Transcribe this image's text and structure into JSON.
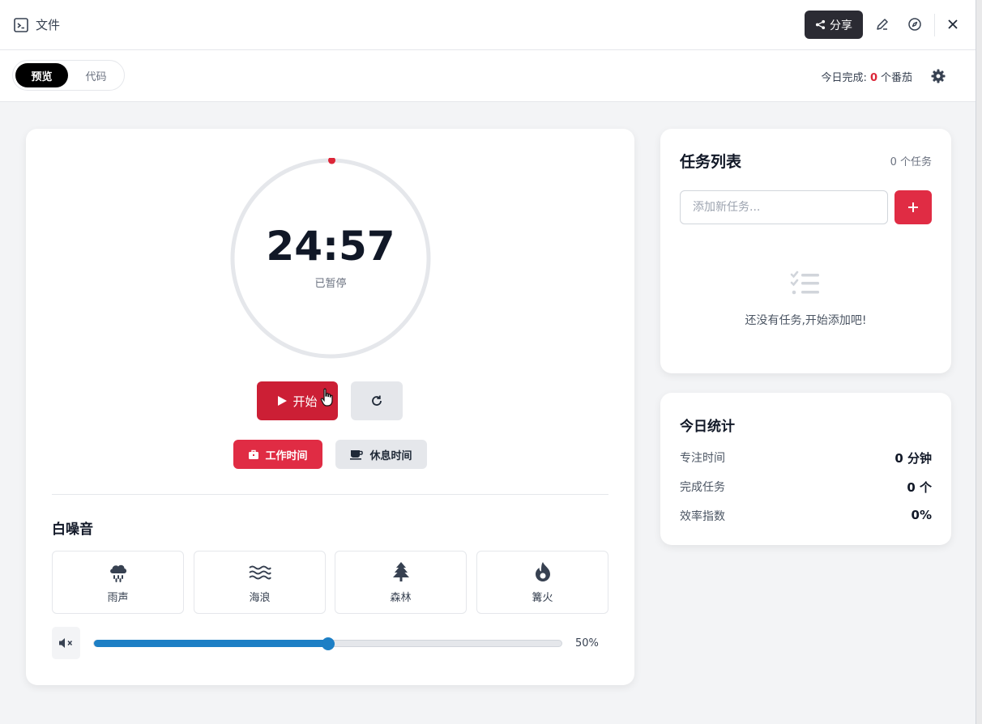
{
  "topbar": {
    "file_label": "文件",
    "share_label": "分享",
    "icons": [
      "terminal-file-icon",
      "share-icon",
      "pencil-icon",
      "compass-icon",
      "close-icon"
    ]
  },
  "subbar": {
    "tabs": [
      {
        "label": "预览",
        "active": true
      },
      {
        "label": "代码",
        "active": false
      }
    ],
    "today_prefix": "今日完成:",
    "today_count": "0",
    "today_suffix": "个番茄"
  },
  "timer": {
    "time": "24:57",
    "state": "已暂停",
    "start_label": "开始",
    "progress": 0.002,
    "modes": [
      {
        "label": "工作时间",
        "active": true,
        "icon": "briefcase-icon"
      },
      {
        "label": "休息时间",
        "active": false,
        "icon": "coffee-icon"
      }
    ]
  },
  "noise": {
    "title": "白噪音",
    "items": [
      {
        "label": "雨声",
        "icon": "rain-cloud-icon"
      },
      {
        "label": "海浪",
        "icon": "water-waves-icon"
      },
      {
        "label": "森林",
        "icon": "tree-icon"
      },
      {
        "label": "篝火",
        "icon": "fire-icon"
      }
    ],
    "volume": 50,
    "volume_label": "50%"
  },
  "tasks": {
    "title": "任务列表",
    "count_label": "0 个任务",
    "input_placeholder": "添加新任务...",
    "empty_text": "还没有任务,开始添加吧!"
  },
  "stats": {
    "title": "今日统计",
    "rows": [
      {
        "label": "专注时间",
        "value": "0 分钟"
      },
      {
        "label": "完成任务",
        "value": "0 个"
      },
      {
        "label": "效率指数",
        "value": "0%"
      }
    ]
  },
  "colors": {
    "accent_red": "#cc1f35",
    "accent_red_light": "#e02c44",
    "slider_blue": "#1d7fc5",
    "share_dark": "#2b2b33"
  }
}
